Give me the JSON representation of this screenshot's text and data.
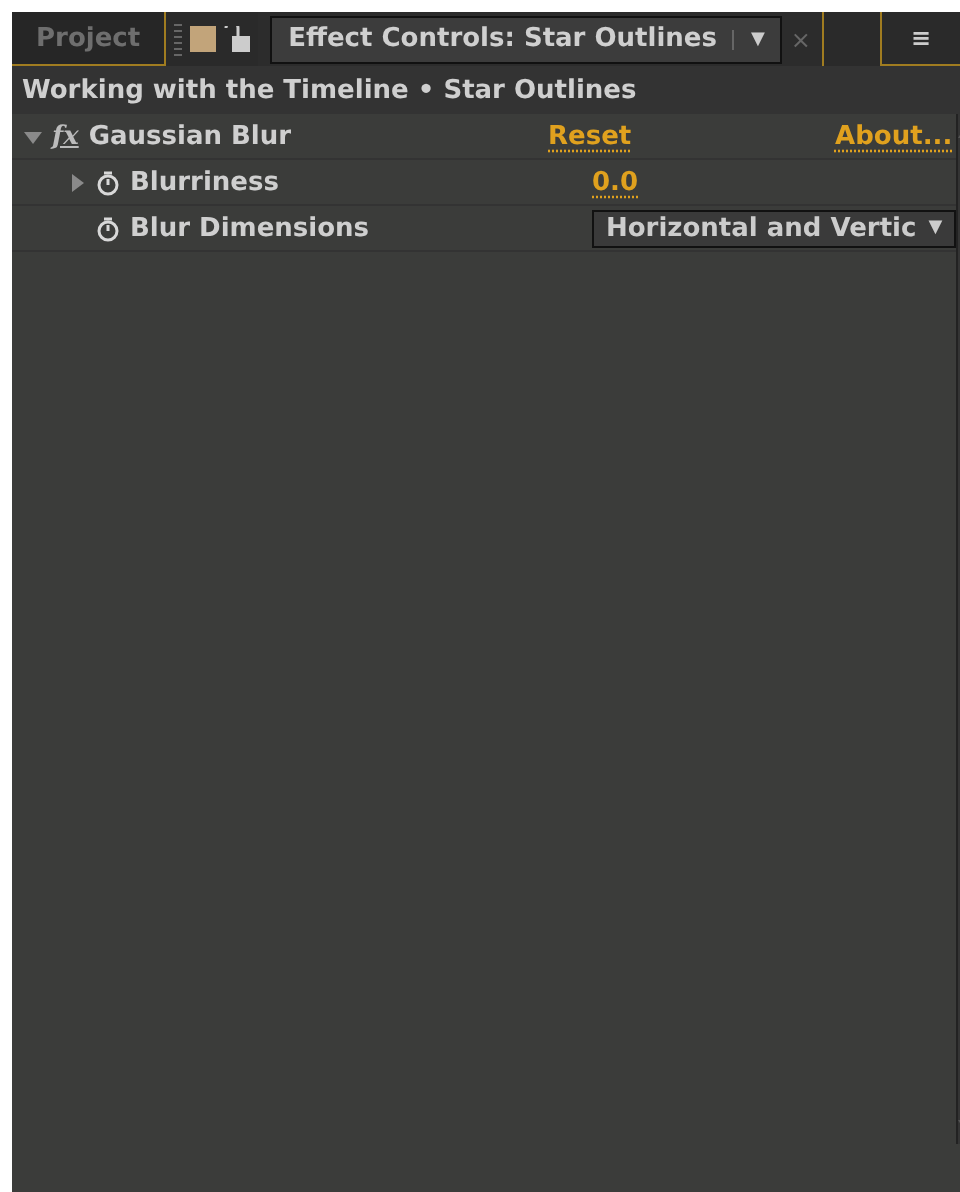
{
  "tabs": [
    {
      "label": "Project",
      "selected": false
    },
    {
      "label": "Effect Controls: Star Outlines",
      "selected": true,
      "dropdown": "▼",
      "close": "×"
    }
  ],
  "panel_menu": "≡",
  "breadcrumb": "Working with the Timeline • Star Outlines",
  "effects": [
    {
      "badge": "fx",
      "name": "Gaussian Blur",
      "expanded": true,
      "reset": "Reset",
      "about": "About...",
      "properties": [
        {
          "kind": "value",
          "name": "Blurriness",
          "expanded": false,
          "value": "0.0"
        },
        {
          "kind": "dropdown",
          "name": "Blur Dimensions",
          "value": "Horizontal and Vertic",
          "arrow": "▼"
        }
      ]
    }
  ]
}
